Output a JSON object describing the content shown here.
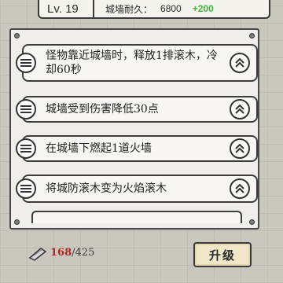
{
  "topbar": {
    "level": "Lv. 19",
    "durability_label": "城墙耐久：",
    "durability_value": "6800",
    "durability_bonus": "+200"
  },
  "skills": [
    {
      "text": "怪物靠近城墙时，释放1排滚木，冷却60秒"
    },
    {
      "text": "城墙受到伤害降低30点"
    },
    {
      "text": "在城墙下燃起1道火墙"
    },
    {
      "text": "将城防滚木变为火焰滚木"
    }
  ],
  "footer": {
    "resource_current": "168",
    "resource_max": "/425",
    "upgrade_label": "升级"
  },
  "icons": {
    "skill_badge": "stripes-icon",
    "upgrade_arrow": "double-chevron-up-icon",
    "resource": "whetstone-icon"
  },
  "colors": {
    "bonus": "#3fb43f",
    "resource_current": "#b3261e"
  }
}
